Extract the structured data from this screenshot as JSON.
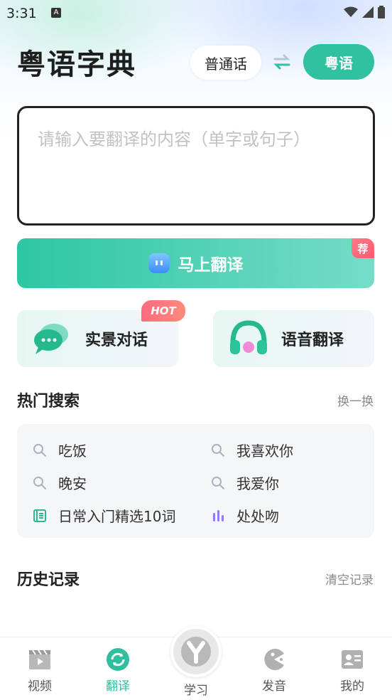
{
  "status_bar": {
    "time": "3:31",
    "a_badge": "A"
  },
  "header": {
    "title": "粤语字典",
    "lang_from": "普通话",
    "lang_to": "粤语"
  },
  "input": {
    "placeholder": "请输入要翻译的内容（单字或句子）",
    "value": ""
  },
  "translate_button": {
    "label": "马上翻译",
    "badge": "荐"
  },
  "features": [
    {
      "label": "实景对话",
      "badge": "HOT"
    },
    {
      "label": "语音翻译"
    }
  ],
  "hot_search": {
    "title": "热门搜索",
    "action": "换一换",
    "items": [
      {
        "label": "吃饭",
        "icon": "search-icon"
      },
      {
        "label": "我喜欢你",
        "icon": "search-icon"
      },
      {
        "label": "晚安",
        "icon": "search-icon"
      },
      {
        "label": "我爱你",
        "icon": "search-icon"
      },
      {
        "label": "日常入门精选10词",
        "icon": "list-book-icon"
      },
      {
        "label": "处处吻",
        "icon": "audio-bars-icon"
      }
    ]
  },
  "history": {
    "title": "历史记录",
    "action": "清空记录"
  },
  "tabbar": {
    "active": "翻译",
    "items": [
      {
        "label": "视频",
        "icon": "video-clapper-icon"
      },
      {
        "label": "翻译",
        "icon": "refresh-translate-icon"
      },
      {
        "label": "学习",
        "icon": "y-logo-icon"
      },
      {
        "label": "发音",
        "icon": "pacman-pronounce-icon"
      },
      {
        "label": "我的",
        "icon": "id-card-icon"
      }
    ]
  },
  "colors": {
    "accent": "#2fc1a0",
    "badge": "#ff6b7e",
    "text": "#222222",
    "muted": "#8a8a8a"
  }
}
